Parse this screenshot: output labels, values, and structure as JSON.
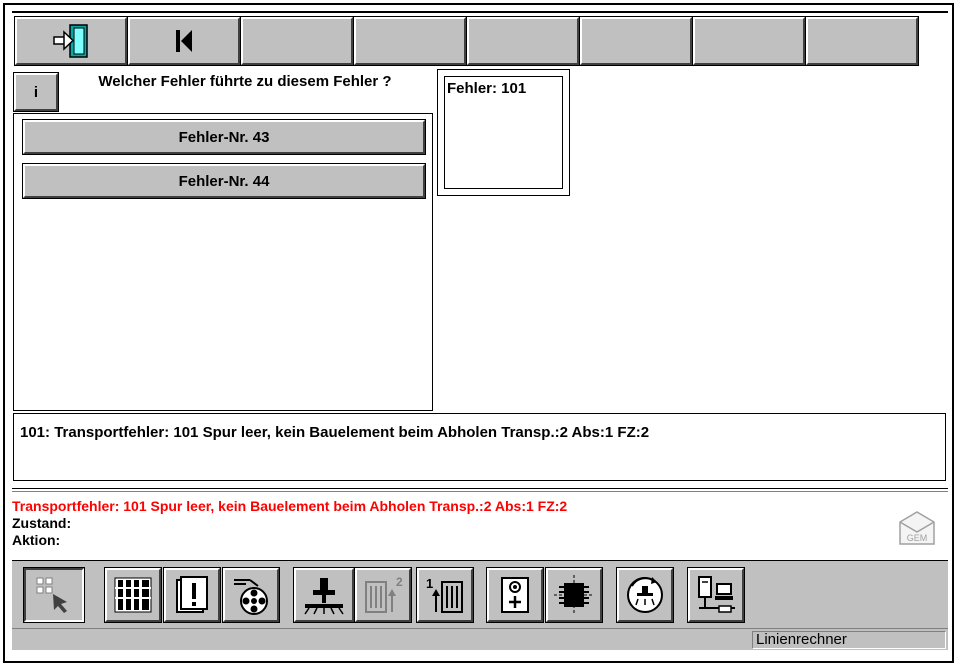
{
  "toolbar": {
    "buttons": [
      {
        "icon": "exit-door-icon"
      },
      {
        "icon": "skip-to-start-icon"
      },
      {
        "icon": ""
      },
      {
        "icon": ""
      },
      {
        "icon": ""
      },
      {
        "icon": ""
      },
      {
        "icon": ""
      },
      {
        "icon": ""
      }
    ]
  },
  "info_button_label": "i",
  "question": "Welcher Fehler führte zu diesem Fehler ?",
  "error_options": [
    {
      "label": "Fehler-Nr. 43"
    },
    {
      "label": "Fehler-Nr. 44"
    }
  ],
  "current_error_label": "Fehler: 101",
  "description": "101: Transportfehler: 101  Spur leer, kein Bauelement beim Abholen  Transp.:2  Abs:1  FZ:2",
  "status": {
    "message": "Transportfehler: 101  Spur leer, kein Bauelement beim Abholen  Transp.:2  Abs:1  FZ:2",
    "message_color": "#ff0000",
    "state_label": "Zustand:",
    "action_label": "Aktion:",
    "gem_label": "GEM"
  },
  "bottom_toolbar": {
    "buttons": [
      {
        "icon": "select-cursor-icon",
        "selected": true
      },
      {
        "icon": "feeder-rack-icon"
      },
      {
        "icon": "alert-document-icon"
      },
      {
        "icon": "tape-reel-icon"
      },
      {
        "icon": "placement-head-icon"
      },
      {
        "icon": "stack-level-2-icon",
        "disabled": true
      },
      {
        "icon": "stack-level-1-icon"
      },
      {
        "icon": "camera-add-icon"
      },
      {
        "icon": "component-chip-icon"
      },
      {
        "icon": "rotate-nozzle-icon"
      },
      {
        "icon": "network-computer-icon"
      }
    ]
  },
  "statusbar_text": "Linienrechner"
}
